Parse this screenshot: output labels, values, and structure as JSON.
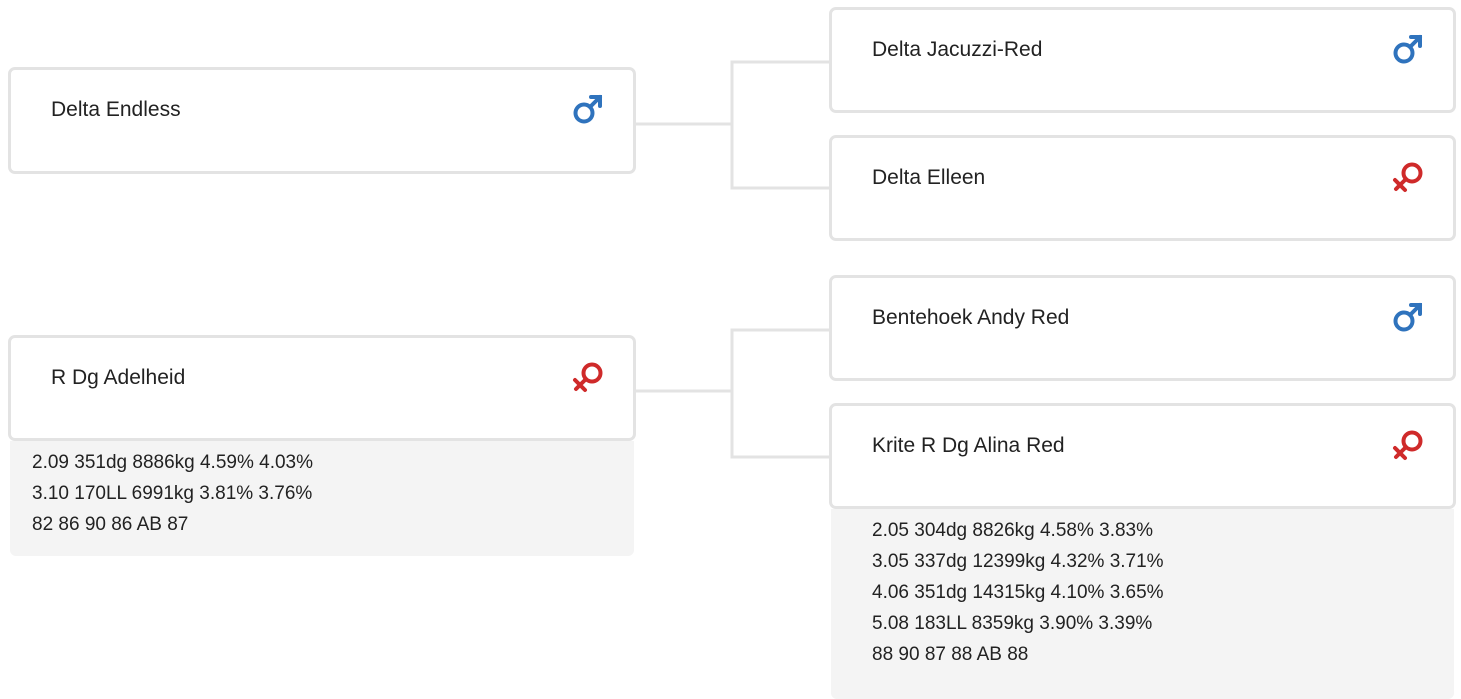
{
  "colors": {
    "male": "#2f73bd",
    "female": "#cf2a2a",
    "card_border": "#e3e3e3",
    "connector": "#e3e3e3",
    "info_bg": "#f4f4f4"
  },
  "pedigree": {
    "sire": {
      "name": "Delta Endless",
      "sex": "male",
      "icon": "male-icon"
    },
    "dam": {
      "name": "R Dg Adelheid",
      "sex": "female",
      "icon": "female-icon",
      "info": [
        "2.09 351dg 8886kg 4.59% 4.03%",
        "3.10 170LL 6991kg 3.81% 3.76%",
        "82 86 90 86 AB 87"
      ]
    },
    "sire_sire": {
      "name": "Delta Jacuzzi-Red",
      "sex": "male",
      "icon": "male-icon"
    },
    "sire_dam": {
      "name": "Delta Elleen",
      "sex": "female",
      "icon": "female-icon"
    },
    "dam_sire": {
      "name": "Bentehoek Andy Red",
      "sex": "male",
      "icon": "male-icon"
    },
    "dam_dam": {
      "name": "Krite R Dg Alina Red",
      "sex": "female",
      "icon": "female-icon",
      "info": [
        "2.05 304dg 8826kg 4.58% 3.83%",
        "3.05 337dg 12399kg 4.32% 3.71%",
        "4.06 351dg 14315kg 4.10% 3.65%",
        "5.08 183LL 8359kg 3.90% 3.39%",
        "88 90 87 88 AB 88"
      ]
    }
  }
}
